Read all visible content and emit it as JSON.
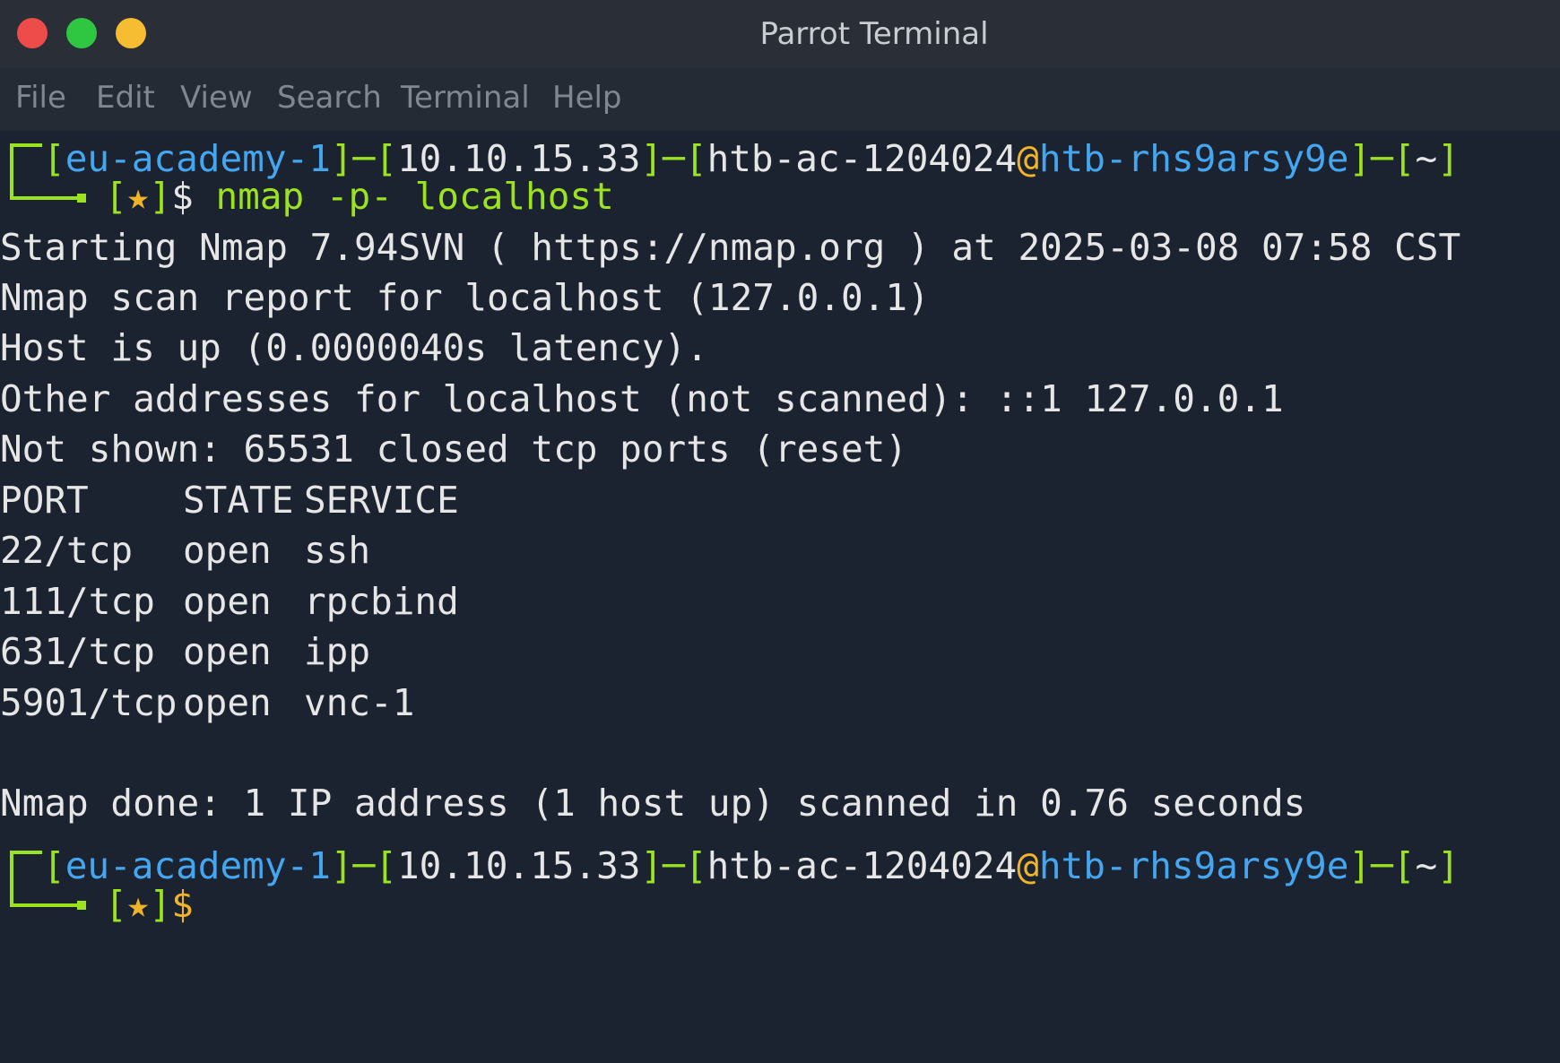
{
  "window": {
    "title": "Parrot Terminal",
    "controls": [
      "close",
      "maximize",
      "minimize"
    ],
    "colors": {
      "close": "#ee4b4b",
      "maximize": "#2fc742",
      "minimize": "#f6bd33"
    }
  },
  "menu": [
    "File",
    "Edit",
    "View",
    "Search",
    "Terminal",
    "Help"
  ],
  "prompt": {
    "host_tag": "eu-academy-1",
    "ip": "10.10.15.33",
    "user": "htb-ac-1204024",
    "at": "@",
    "machine": "htb-rhs9arsy9e",
    "dir": "~",
    "star": "★",
    "symbol": "$"
  },
  "command": "nmap -p- localhost",
  "output": [
    "Starting Nmap 7.94SVN ( https://nmap.org ) at 2025-03-08 07:58 CST",
    "Nmap scan report for localhost (127.0.0.1)",
    "Host is up (0.0000040s latency).",
    "Other addresses for localhost (not scanned): ::1 127.0.0.1",
    "Not shown: 65531 closed tcp ports (reset)"
  ],
  "ports_table": {
    "headers": [
      "PORT",
      "STATE",
      "SERVICE"
    ],
    "rows": [
      [
        "22/tcp",
        "open",
        "ssh"
      ],
      [
        "111/tcp",
        "open",
        "rpcbind"
      ],
      [
        "631/tcp",
        "open",
        "ipp"
      ],
      [
        "5901/tcp",
        "open",
        "vnc-1"
      ]
    ]
  },
  "done_line": "Nmap done: 1 IP address (1 host up) scanned in 0.76 seconds",
  "colors": {
    "background": "#1b2230",
    "prompt_green": "#9be31f",
    "prompt_blue": "#45a6f0",
    "prompt_orange": "#f0b429",
    "text": "#e6e6e6"
  }
}
